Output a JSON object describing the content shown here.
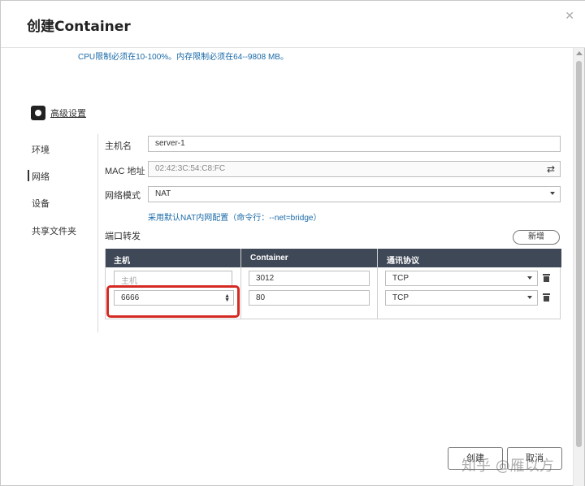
{
  "dialog": {
    "title": "创建Container"
  },
  "hint": "CPU限制必须在10-100%。内存限制必须在64--9808 MB。",
  "advanced": {
    "label": "高级设置"
  },
  "sidebar": {
    "items": [
      {
        "label": "环境"
      },
      {
        "label": "网络"
      },
      {
        "label": "设备"
      },
      {
        "label": "共享文件夹"
      }
    ]
  },
  "network": {
    "hostname_label": "主机名",
    "hostname_value": "server-1",
    "mac_label": "MAC 地址",
    "mac_value": "02:42:3C:54:C8:FC",
    "mode_label": "网络模式",
    "mode_value": "NAT",
    "mode_note": "采用默认NAT内网配置（命令行：--net=bridge）",
    "port_label": "端口转发",
    "add_button": "新增",
    "table": {
      "headers": [
        "主机",
        "Container",
        "通讯协议"
      ],
      "rows": [
        {
          "host": "",
          "host_placeholder": "主机",
          "container": "3012",
          "protocol": "TCP"
        },
        {
          "host": "6666",
          "container": "80",
          "protocol": "TCP"
        }
      ]
    }
  },
  "footer": {
    "create_label": "创建",
    "cancel_label": "取消"
  },
  "watermark": "知乎 @雁以方",
  "colors": {
    "highlight": "#d42a23",
    "link": "#1a6aa8",
    "table_header": "#3f4856"
  }
}
